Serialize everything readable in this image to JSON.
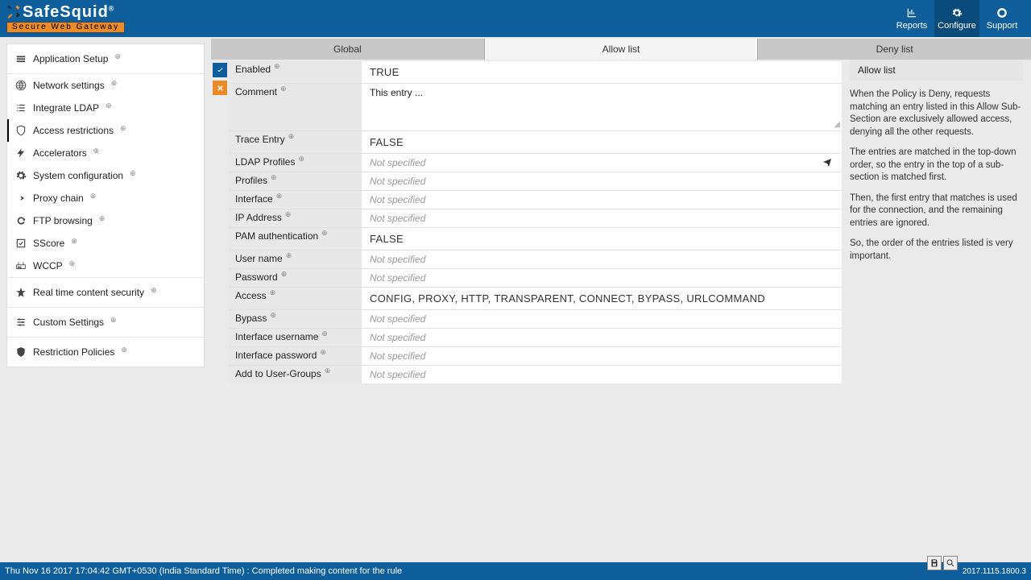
{
  "brand": {
    "name": "SafeSquid",
    "reg": "®",
    "tagline": "Secure Web Gateway"
  },
  "top_actions": {
    "reports": "Reports",
    "configure": "Configure",
    "support": "Support"
  },
  "sidebar": {
    "groups": [
      [
        {
          "label": "Application Setup",
          "icon": "stack",
          "header": true
        }
      ],
      [
        {
          "label": "Network settings",
          "icon": "globe"
        },
        {
          "label": "Integrate LDAP",
          "icon": "list"
        },
        {
          "label": "Access restrictions",
          "icon": "shield",
          "active": true
        },
        {
          "label": "Accelerators",
          "icon": "bolt"
        },
        {
          "label": "System configuration",
          "icon": "gear"
        },
        {
          "label": "Proxy chain",
          "icon": "forward"
        },
        {
          "label": "FTP browsing",
          "icon": "refresh"
        },
        {
          "label": "SScore",
          "icon": "check"
        },
        {
          "label": "WCCP",
          "icon": "router"
        }
      ],
      [
        {
          "label": "Real time content security",
          "icon": "star",
          "header": true
        }
      ],
      [
        {
          "label": "Custom Settings",
          "icon": "sliders",
          "header": true
        }
      ],
      [
        {
          "label": "Restriction Policies",
          "icon": "badge",
          "header": true
        }
      ]
    ]
  },
  "tabs": {
    "items": [
      "Global",
      "Allow list",
      "Deny list"
    ],
    "active": 1
  },
  "form": [
    {
      "key": "Enabled",
      "val": "TRUE",
      "style": "big"
    },
    {
      "key": "Comment",
      "val": "This entry ...",
      "style": "comment"
    },
    {
      "key": "Trace Entry",
      "val": "FALSE",
      "style": "big"
    },
    {
      "key": "LDAP Profiles",
      "val": "Not specified",
      "style": "muted",
      "send": true
    },
    {
      "key": "Profiles",
      "val": "Not specified",
      "style": "muted"
    },
    {
      "key": "Interface",
      "val": "Not specified",
      "style": "muted"
    },
    {
      "key": "IP Address",
      "val": "Not specified",
      "style": "muted"
    },
    {
      "key": "PAM authentication",
      "val": "FALSE",
      "style": "big"
    },
    {
      "key": "User name",
      "val": "Not specified",
      "style": "muted"
    },
    {
      "key": "Password",
      "val": "Not specified",
      "style": "muted"
    },
    {
      "key": "Access",
      "val": "CONFIG,   PROXY,   HTTP,   TRANSPARENT,   CONNECT,   BYPASS,   URLCOMMAND",
      "style": "big"
    },
    {
      "key": "Bypass",
      "val": "Not specified",
      "style": "muted"
    },
    {
      "key": "Interface username",
      "val": "Not specified",
      "style": "muted"
    },
    {
      "key": "Interface password",
      "val": "Not specified",
      "style": "muted"
    },
    {
      "key": "Add to User-Groups",
      "val": "Not specified",
      "style": "muted"
    }
  ],
  "info": {
    "title": "Allow list",
    "paras": [
      "When the Policy is Deny, requests matching an entry listed in this Allow Sub-Section are exclusively allowed access, denying all the other requests.",
      "The entries are matched in the top-down order, so the entry in the top of a sub-section is matched first.",
      "Then, the first entry that matches is used for the connection, and the remaining entries are ignored.",
      "So, the order of the entries listed is very important."
    ]
  },
  "footer": {
    "status": "Thu Nov 16 2017 17:04:42 GMT+0530 (India Standard Time) : Completed making content for the rule",
    "version": "2017.1115.1800.3"
  }
}
